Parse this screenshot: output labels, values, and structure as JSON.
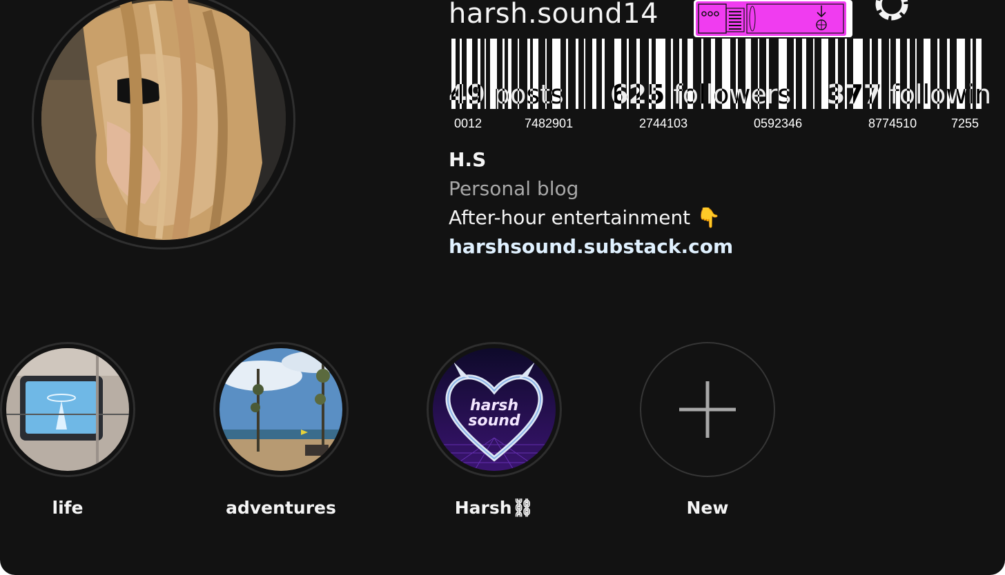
{
  "profile": {
    "username": "harsh.sound14",
    "full_name": "H.S",
    "category": "Personal blog",
    "bio": "After-hour entertainment 👇",
    "link": "harshsound.substack.com"
  },
  "stats": {
    "posts": {
      "count": "49",
      "label": "posts"
    },
    "followers": {
      "count": "625",
      "label": "followers"
    },
    "following": {
      "count": "377",
      "label": "followin"
    }
  },
  "barcode_numbers": [
    "0012",
    "7482901",
    "2744103",
    "0592346",
    "8774510",
    "7255"
  ],
  "highlights": [
    {
      "label": "life"
    },
    {
      "label": "adventures"
    },
    {
      "label": "Harsh⛓",
      "art_text_1": "harsh",
      "art_text_2": "sound"
    },
    {
      "label": "New"
    }
  ],
  "icons": {
    "settings": "gear-icon",
    "add": "plus-icon",
    "sticker": "barcode-sticker-icon"
  },
  "colors": {
    "background": "#121212",
    "text": "#f5f5f5",
    "secondary_text": "#a8a8a8",
    "link": "#e0f1ff",
    "sticker": "#f03cf0"
  }
}
